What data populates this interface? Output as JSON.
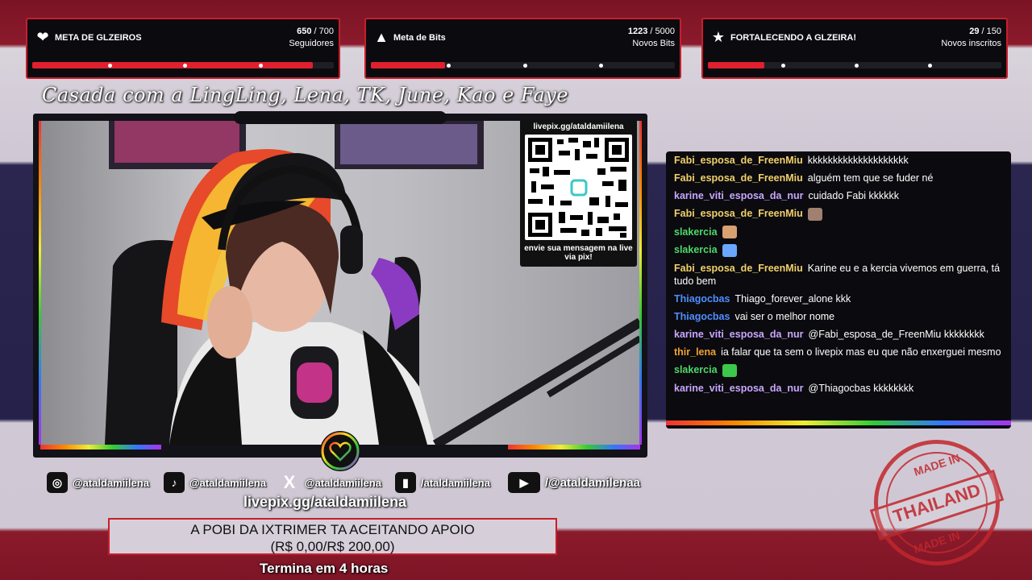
{
  "goals": [
    {
      "title": "META DE GLZEIROS",
      "icon": "heart-icon",
      "current": "650",
      "total": " / 700",
      "sub": "Seguidores",
      "progress": 0.93
    },
    {
      "title": "Meta de Bits",
      "icon": "bits-icon",
      "current": "1223",
      "total": " / 5000",
      "sub": "Novos Bits",
      "progress": 0.245
    },
    {
      "title": "FORTALECENDO A GLZEIRA!",
      "icon": "star-icon",
      "current": "29",
      "total": " / 150",
      "sub": "Novos inscritos",
      "progress": 0.193
    }
  ],
  "tagline": "Casada com a LingLing, Lena, TK, June, Kao e Faye",
  "qr": {
    "url": "livepix.gg/ataldamiilena",
    "caption": "envie sua mensagem na live via pix!"
  },
  "chat": [
    {
      "user": "Fabi_esposa_de_FreenMiu",
      "color": "#f2d06b",
      "text": "kkkkkkkkkkkkkkkkkkkk"
    },
    {
      "user": "Fabi_esposa_de_FreenMiu",
      "color": "#f2d06b",
      "text": "alguém tem que se fuder né"
    },
    {
      "user": "karine_viti_esposa_da_nur",
      "color": "#c9a6ff",
      "text": "cuidado Fabi kkkkkk"
    },
    {
      "user": "Fabi_esposa_de_FreenMiu",
      "color": "#f2d06b",
      "text": "",
      "emote": "#a08070"
    },
    {
      "user": "slakercia",
      "color": "#4fd86a",
      "text": "",
      "emote": "#d9a070"
    },
    {
      "user": "slakercia",
      "color": "#4fd86a",
      "text": "",
      "emote": "#6aa8ff"
    },
    {
      "user": "Fabi_esposa_de_FreenMiu",
      "color": "#f2d06b",
      "text": "Karine eu e a kercia vivemos em guerra, tá tudo bem"
    },
    {
      "user": "Thiagocbas",
      "color": "#4f8dff",
      "text": "Thiago_forever_alone kkk"
    },
    {
      "user": "Thiagocbas",
      "color": "#4f8dff",
      "text": "vai ser o melhor nome"
    },
    {
      "user": "karine_viti_esposa_da_nur",
      "color": "#c9a6ff",
      "text": "@Fabi_esposa_de_FreenMiu kkkkkkkk"
    },
    {
      "user": "thir_lena",
      "color": "#f0a030",
      "text": "ia falar que ta sem o livepix mas eu que não enxerguei mesmo"
    },
    {
      "user": "slakercia",
      "color": "#4fd86a",
      "text": "",
      "emote": "#3cc84a"
    },
    {
      "user": "karine_viti_esposa_da_nur",
      "color": "#c9a6ff",
      "text": "@Thiagocbas kkkkkkkk"
    }
  ],
  "socials": [
    {
      "icon": "instagram-icon",
      "glyph": "◎",
      "handle": "@ataldamiilena"
    },
    {
      "icon": "tiktok-icon",
      "glyph": "♪",
      "handle": "@ataldamiilena"
    },
    {
      "icon": "x-icon",
      "glyph": "X",
      "handle": "@ataldamiilena"
    },
    {
      "icon": "twitch-icon",
      "glyph": "▮",
      "handle": "/ataldamiilena"
    },
    {
      "icon": "youtube-icon",
      "glyph": "▶",
      "handle": "/@ataldamilenaa"
    }
  ],
  "livepix_url": "livepix.gg/ataldamiilena",
  "donation": {
    "line1": "A POBI DA IXTRIMER TA ACEITANDO APOIO",
    "line2": "(R$ 0,00/R$ 200,00)",
    "ends": "Termina em 4 horas"
  },
  "stamp": {
    "top": "MADE IN",
    "middle": "THAILAND",
    "bottom": "MADE IN"
  }
}
